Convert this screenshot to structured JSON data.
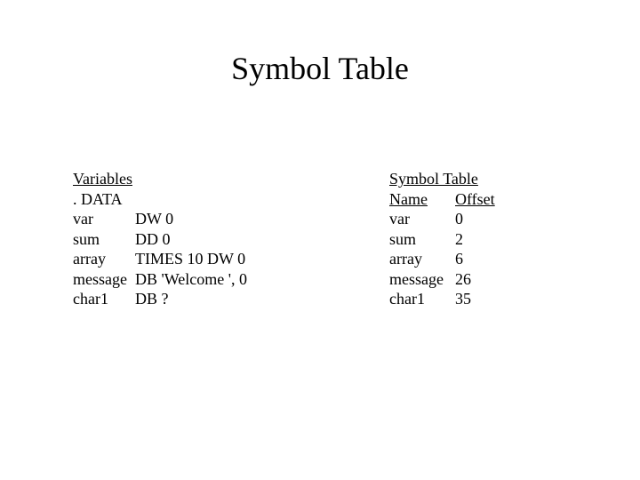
{
  "title": "Symbol Table",
  "left": {
    "heading": "Variables",
    "section": ". DATA",
    "rows": [
      {
        "name": "var",
        "def": "DW 0"
      },
      {
        "name": "sum",
        "def": "DD 0"
      },
      {
        "name": "array",
        "def": "TIMES 10 DW 0"
      },
      {
        "name": "message",
        "def": "DB 'Welcome ', 0"
      },
      {
        "name": "char1",
        "def": "DB ?"
      }
    ]
  },
  "right": {
    "heading": "Symbol Table",
    "col_name": "Name",
    "col_offset": "Offset",
    "rows": [
      {
        "name": "var",
        "offset": "0"
      },
      {
        "name": "sum",
        "offset": "2"
      },
      {
        "name": "array",
        "offset": "6"
      },
      {
        "name": "message",
        "offset": "26"
      },
      {
        "name": "char1",
        "offset": "35"
      }
    ]
  },
  "chart_data": {
    "type": "table",
    "title": "Symbol Table",
    "columns": [
      "Name",
      "Offset"
    ],
    "rows": [
      [
        "var",
        0
      ],
      [
        "sum",
        2
      ],
      [
        "array",
        6
      ],
      [
        "message",
        26
      ],
      [
        "char1",
        35
      ]
    ]
  }
}
